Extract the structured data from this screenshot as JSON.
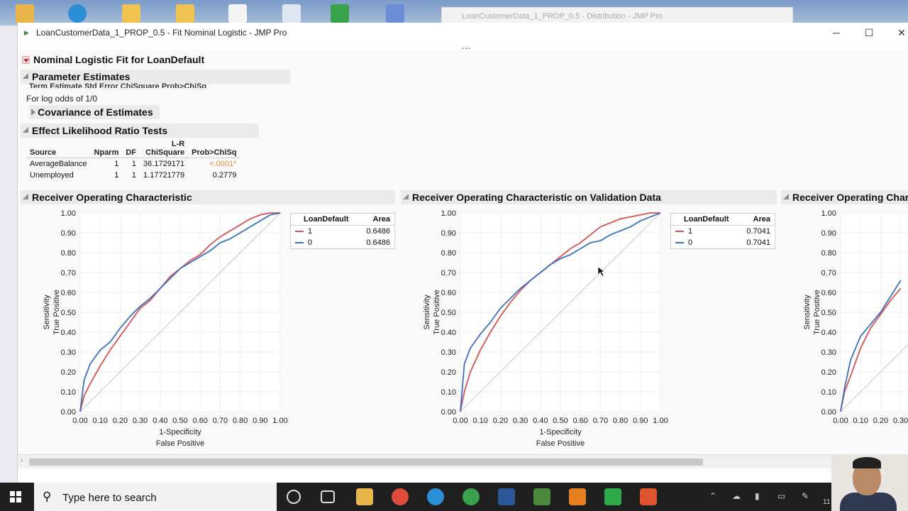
{
  "window": {
    "title": "LoanCustomerData_1_PROP_0.5 - Fit Nominal Logistic - JMP Pro",
    "background_tab_title": "LoanCustomerData_1_PROP_0.5 - Distribution - JMP Pro",
    "controls": {
      "minimize": "─",
      "maximize": "☐",
      "close": "✕"
    },
    "menu_dots": "…"
  },
  "report": {
    "main_title": "Nominal Logistic Fit for LoanDefault",
    "parameter_estimates": {
      "title": "Parameter Estimates",
      "clipped_header": "Term                Estimate   Std Error   ChiSquare   Prob>ChiSq",
      "note": "For log odds of 1/0"
    },
    "covariance": {
      "title": "Covariance of Estimates"
    },
    "effect_lr": {
      "title": "Effect Likelihood Ratio Tests",
      "columns": {
        "source": "Source",
        "nparm": "Nparm",
        "df": "DF",
        "lr_top": "L-R",
        "lr_bottom": "ChiSquare",
        "prob": "Prob>ChiSq"
      },
      "rows": [
        {
          "source": "AverageBalance",
          "nparm": "1",
          "df": "1",
          "chisq": "36.1729171",
          "prob": "<.0001*"
        },
        {
          "source": "Unemployed",
          "nparm": "1",
          "df": "1",
          "chisq": "1.17721779",
          "prob": "0.2779"
        }
      ]
    },
    "roc_titles": {
      "training": "Receiver Operating Characteristic",
      "validation": "Receiver Operating Characteristic on Validation Data",
      "third": "Receiver Operating Characteristic on Test Data"
    },
    "axis_text": {
      "y_line1": "Sensitivity",
      "y_line2": "True Positive",
      "x_line1": "1-Specificity",
      "x_line2": "False Positive"
    },
    "legend_columns": {
      "level": "LoanDefault",
      "area": "Area"
    },
    "legend_training": [
      {
        "level": "1",
        "area": "0.6486",
        "color": "#d9534f"
      },
      {
        "level": "0",
        "area": "0.6486",
        "color": "#3b6fc4"
      }
    ],
    "legend_validation": [
      {
        "level": "1",
        "area": "0.7041",
        "color": "#d9534f"
      },
      {
        "level": "0",
        "area": "0.7041",
        "color": "#3b6fc4"
      }
    ]
  },
  "chart_data": [
    {
      "type": "line",
      "title": "Receiver Operating Characteristic",
      "xlabel": "1-Specificity / False Positive",
      "ylabel": "Sensitivity / True Positive",
      "xlim": [
        0,
        1
      ],
      "ylim": [
        0,
        1
      ],
      "ticks": [
        "0.00",
        "0.10",
        "0.20",
        "0.30",
        "0.40",
        "0.50",
        "0.60",
        "0.70",
        "0.80",
        "0.90",
        "1.00"
      ],
      "grid": true,
      "series": [
        {
          "name": "1",
          "color": "#d9534f",
          "x": [
            0,
            0.02,
            0.05,
            0.1,
            0.15,
            0.2,
            0.25,
            0.3,
            0.35,
            0.4,
            0.45,
            0.5,
            0.55,
            0.6,
            0.65,
            0.7,
            0.75,
            0.8,
            0.85,
            0.9,
            0.95,
            1
          ],
          "y": [
            0,
            0.08,
            0.14,
            0.23,
            0.31,
            0.38,
            0.45,
            0.52,
            0.56,
            0.62,
            0.68,
            0.72,
            0.76,
            0.79,
            0.84,
            0.88,
            0.91,
            0.94,
            0.97,
            0.99,
            1,
            1
          ]
        },
        {
          "name": "0",
          "color": "#3b6fc4",
          "x": [
            0,
            0.02,
            0.05,
            0.1,
            0.15,
            0.2,
            0.25,
            0.3,
            0.35,
            0.4,
            0.45,
            0.5,
            0.55,
            0.6,
            0.65,
            0.7,
            0.75,
            0.8,
            0.85,
            0.9,
            0.95,
            1
          ],
          "y": [
            0,
            0.16,
            0.24,
            0.31,
            0.35,
            0.42,
            0.48,
            0.53,
            0.57,
            0.62,
            0.67,
            0.72,
            0.75,
            0.78,
            0.81,
            0.85,
            0.87,
            0.9,
            0.93,
            0.96,
            0.99,
            1
          ]
        }
      ]
    },
    {
      "type": "line",
      "title": "Receiver Operating Characteristic on Validation Data",
      "xlabel": "1-Specificity / False Positive",
      "ylabel": "Sensitivity / True Positive",
      "xlim": [
        0,
        1
      ],
      "ylim": [
        0,
        1
      ],
      "ticks": [
        "0.00",
        "0.10",
        "0.20",
        "0.30",
        "0.40",
        "0.50",
        "0.60",
        "0.70",
        "0.80",
        "0.90",
        "1.00"
      ],
      "grid": true,
      "series": [
        {
          "name": "1",
          "color": "#d9534f",
          "x": [
            0,
            0.02,
            0.05,
            0.1,
            0.15,
            0.2,
            0.25,
            0.3,
            0.35,
            0.4,
            0.45,
            0.5,
            0.55,
            0.6,
            0.65,
            0.7,
            0.75,
            0.8,
            0.85,
            0.9,
            0.95,
            1
          ],
          "y": [
            0,
            0.1,
            0.2,
            0.31,
            0.4,
            0.48,
            0.55,
            0.61,
            0.66,
            0.7,
            0.74,
            0.78,
            0.82,
            0.85,
            0.89,
            0.93,
            0.95,
            0.97,
            0.98,
            0.99,
            1,
            1
          ]
        },
        {
          "name": "0",
          "color": "#3b6fc4",
          "x": [
            0,
            0.02,
            0.05,
            0.1,
            0.15,
            0.2,
            0.25,
            0.3,
            0.35,
            0.4,
            0.45,
            0.5,
            0.55,
            0.6,
            0.65,
            0.7,
            0.75,
            0.8,
            0.85,
            0.9,
            0.95,
            1
          ],
          "y": [
            0,
            0.24,
            0.32,
            0.39,
            0.45,
            0.52,
            0.57,
            0.62,
            0.66,
            0.7,
            0.74,
            0.77,
            0.79,
            0.82,
            0.85,
            0.86,
            0.89,
            0.91,
            0.93,
            0.96,
            0.98,
            1
          ]
        }
      ]
    },
    {
      "type": "line",
      "title": "Receiver Operating Characteristic on Test Data",
      "xlim": [
        0,
        1
      ],
      "ylim": [
        0,
        1
      ],
      "ticks": [
        "0.00",
        "0.10",
        "0.20",
        "0.30",
        "0.40",
        "0.50",
        "0.60",
        "0.70",
        "0.80",
        "0.90",
        "1.00"
      ],
      "series": [
        {
          "name": "1",
          "color": "#d9534f",
          "x": [
            0,
            0.02,
            0.05,
            0.1,
            0.15,
            0.2,
            0.25,
            0.3
          ],
          "y": [
            0,
            0.1,
            0.18,
            0.32,
            0.42,
            0.49,
            0.56,
            0.62
          ]
        },
        {
          "name": "0",
          "color": "#3b6fc4",
          "x": [
            0,
            0.02,
            0.05,
            0.1,
            0.15,
            0.2,
            0.25,
            0.3
          ],
          "y": [
            0,
            0.12,
            0.26,
            0.38,
            0.44,
            0.5,
            0.58,
            0.66
          ]
        }
      ]
    }
  ],
  "taskbar": {
    "search_placeholder": "Type here to search",
    "search_icon": "magnifier-icon",
    "tray_time": "11"
  }
}
